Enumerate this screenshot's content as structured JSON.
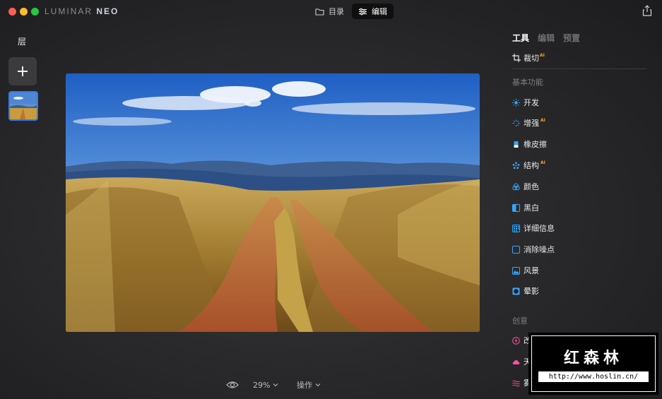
{
  "app": {
    "brand": "LUMINAR",
    "brand_suffix": "NEO"
  },
  "topnav": {
    "catalog": "目录",
    "edit": "编辑"
  },
  "layers": {
    "title": "层"
  },
  "bottom": {
    "zoom": "29%",
    "actions": "操作"
  },
  "tools": {
    "tabs": [
      "工具",
      "编辑",
      "预置"
    ],
    "crop": "裁切",
    "ai_badge": "AI",
    "basic_section": "基本功能",
    "basic_items": [
      {
        "label": "开发",
        "ai": false,
        "icon": "sun-icon"
      },
      {
        "label": "增强",
        "ai": true,
        "icon": "sparkle-icon"
      },
      {
        "label": "橡皮擦",
        "ai": false,
        "icon": "eraser-icon"
      },
      {
        "label": "结构",
        "ai": true,
        "icon": "structure-icon"
      },
      {
        "label": "颜色",
        "ai": false,
        "icon": "color-icon"
      },
      {
        "label": "黑白",
        "ai": false,
        "icon": "bw-icon"
      },
      {
        "label": "详细信息",
        "ai": false,
        "icon": "details-icon"
      },
      {
        "label": "消除噪点",
        "ai": false,
        "icon": "denoise-icon"
      },
      {
        "label": "风景",
        "ai": false,
        "icon": "landscape-icon"
      },
      {
        "label": "晕影",
        "ai": false,
        "icon": "vignette-icon"
      }
    ],
    "creative_section": "创意",
    "creative_items": [
      {
        "label": "改光",
        "ai": true,
        "icon": "relight-icon"
      },
      {
        "label": "天空",
        "ai": true,
        "icon": "sky-icon"
      },
      {
        "label": "雾密",
        "ai": false,
        "icon": "mist-icon"
      }
    ]
  },
  "watermark": {
    "title": "红森林",
    "url": "http://www.hoslin.cn/"
  },
  "colors": {
    "accent_blue": "#2f7cf6",
    "ai_orange": "#ff9b2f",
    "creative_pink": "#ff4fa3",
    "basic_blue": "#33a8ff"
  }
}
